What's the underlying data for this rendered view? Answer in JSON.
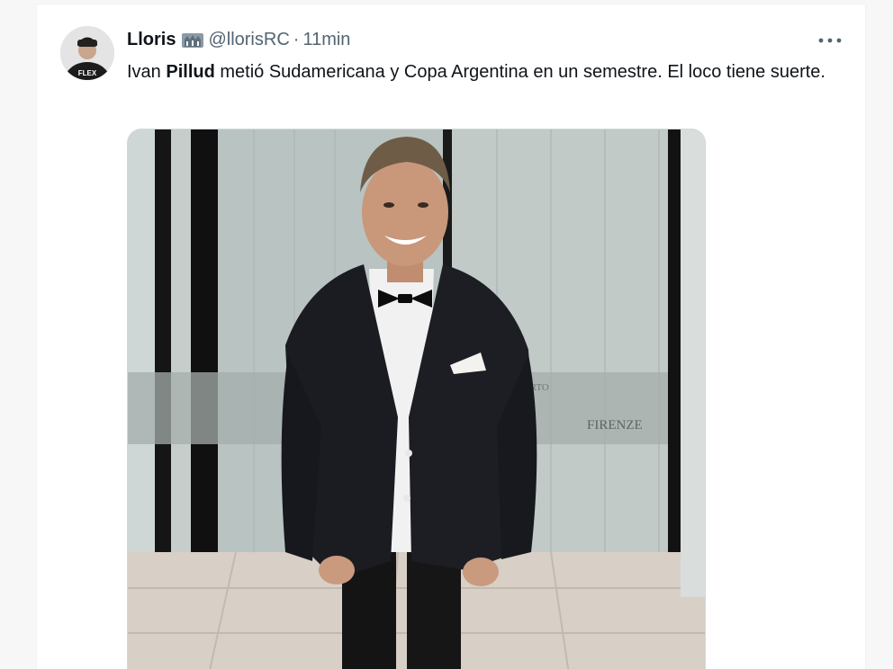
{
  "tweet": {
    "display_name": "Lloris",
    "handle": "@llorisRC",
    "separator": "·",
    "time": "11min",
    "text_before": "Ivan ",
    "text_bold": "Pillud",
    "text_after": " metió Sudamericana y Copa Argentina en un semestre. El loco tiene suerte.",
    "avatar_print": "FLEX",
    "media": {
      "sign_text": "FIRENZE",
      "sign_text_top": "ERTO"
    }
  },
  "icons": {
    "badge": "organization-badge-icon",
    "more": "more-options-icon"
  },
  "colors": {
    "text": "#0f1419",
    "secondary": "#536471",
    "border": "#cfd9de"
  }
}
